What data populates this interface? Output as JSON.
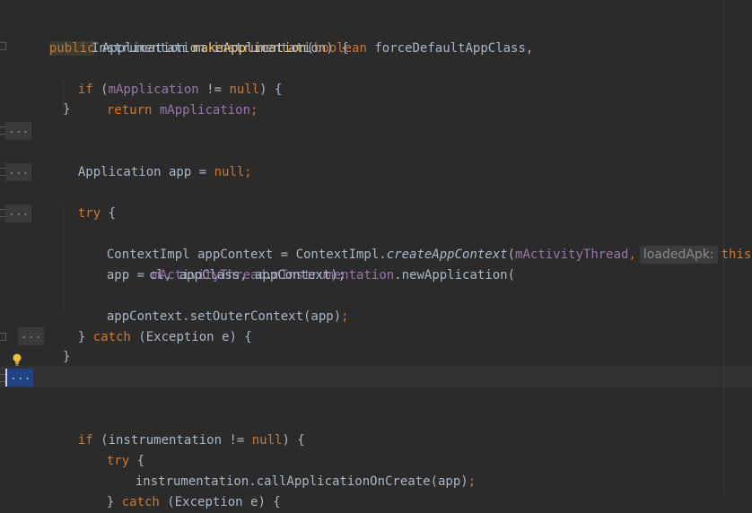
{
  "lines": {
    "l1": {
      "kw": "public",
      "type": " Application ",
      "fn": "makeApplication",
      "p": "(",
      "kw2": "boolean",
      "rest": " forceDefaultAppClass,"
    },
    "l2": "Instrumentation instrumentation) {",
    "l3": {
      "kw": "if",
      "a": " (",
      "fld": "mApplication",
      "b": " != ",
      "kw2": "null",
      "c": ") {"
    },
    "l4": {
      "kw": "return",
      "sp": " ",
      "fld": "mApplication",
      "semi": ";"
    },
    "l5": "}",
    "l6": {
      "a": "Application app = ",
      "kw": "null",
      "semi": ";"
    },
    "l7": {
      "kw": "try",
      "rest": " {"
    },
    "l8": {
      "a": "ContextImpl appContext = ContextImpl.",
      "it": "createAppContext",
      "p": "(",
      "fld": "mActivityThread",
      "comma": ",",
      "hint": "loadedApk:",
      "kw": "this",
      "end": ");"
    },
    "l9": {
      "a": "app = ",
      "fld1": "mActivityThread",
      "dot": ".",
      "fld2": "mInstrumentation",
      "rest": ".newApplication("
    },
    "l10": "cl, appClass, appContext);",
    "l11": {
      "a": "appContext.setOuterContext(app)",
      "semi": ";"
    },
    "l12": {
      "a": "} ",
      "kw": "catch",
      "rest": " (Exception e) {"
    },
    "l13": "}",
    "l14": {
      "kw": "if",
      "a": " (instrumentation != ",
      "kw2": "null",
      "b": ") {"
    },
    "l15": {
      "kw": "try",
      "rest": " {"
    },
    "l16": {
      "a": "instrumentation.callApplicationOnCreate(app)",
      "semi": ";"
    },
    "l17": {
      "a": "} ",
      "kw": "catch",
      "rest": " (Exception e) {"
    }
  },
  "folds": {
    "placeholder": "..."
  }
}
